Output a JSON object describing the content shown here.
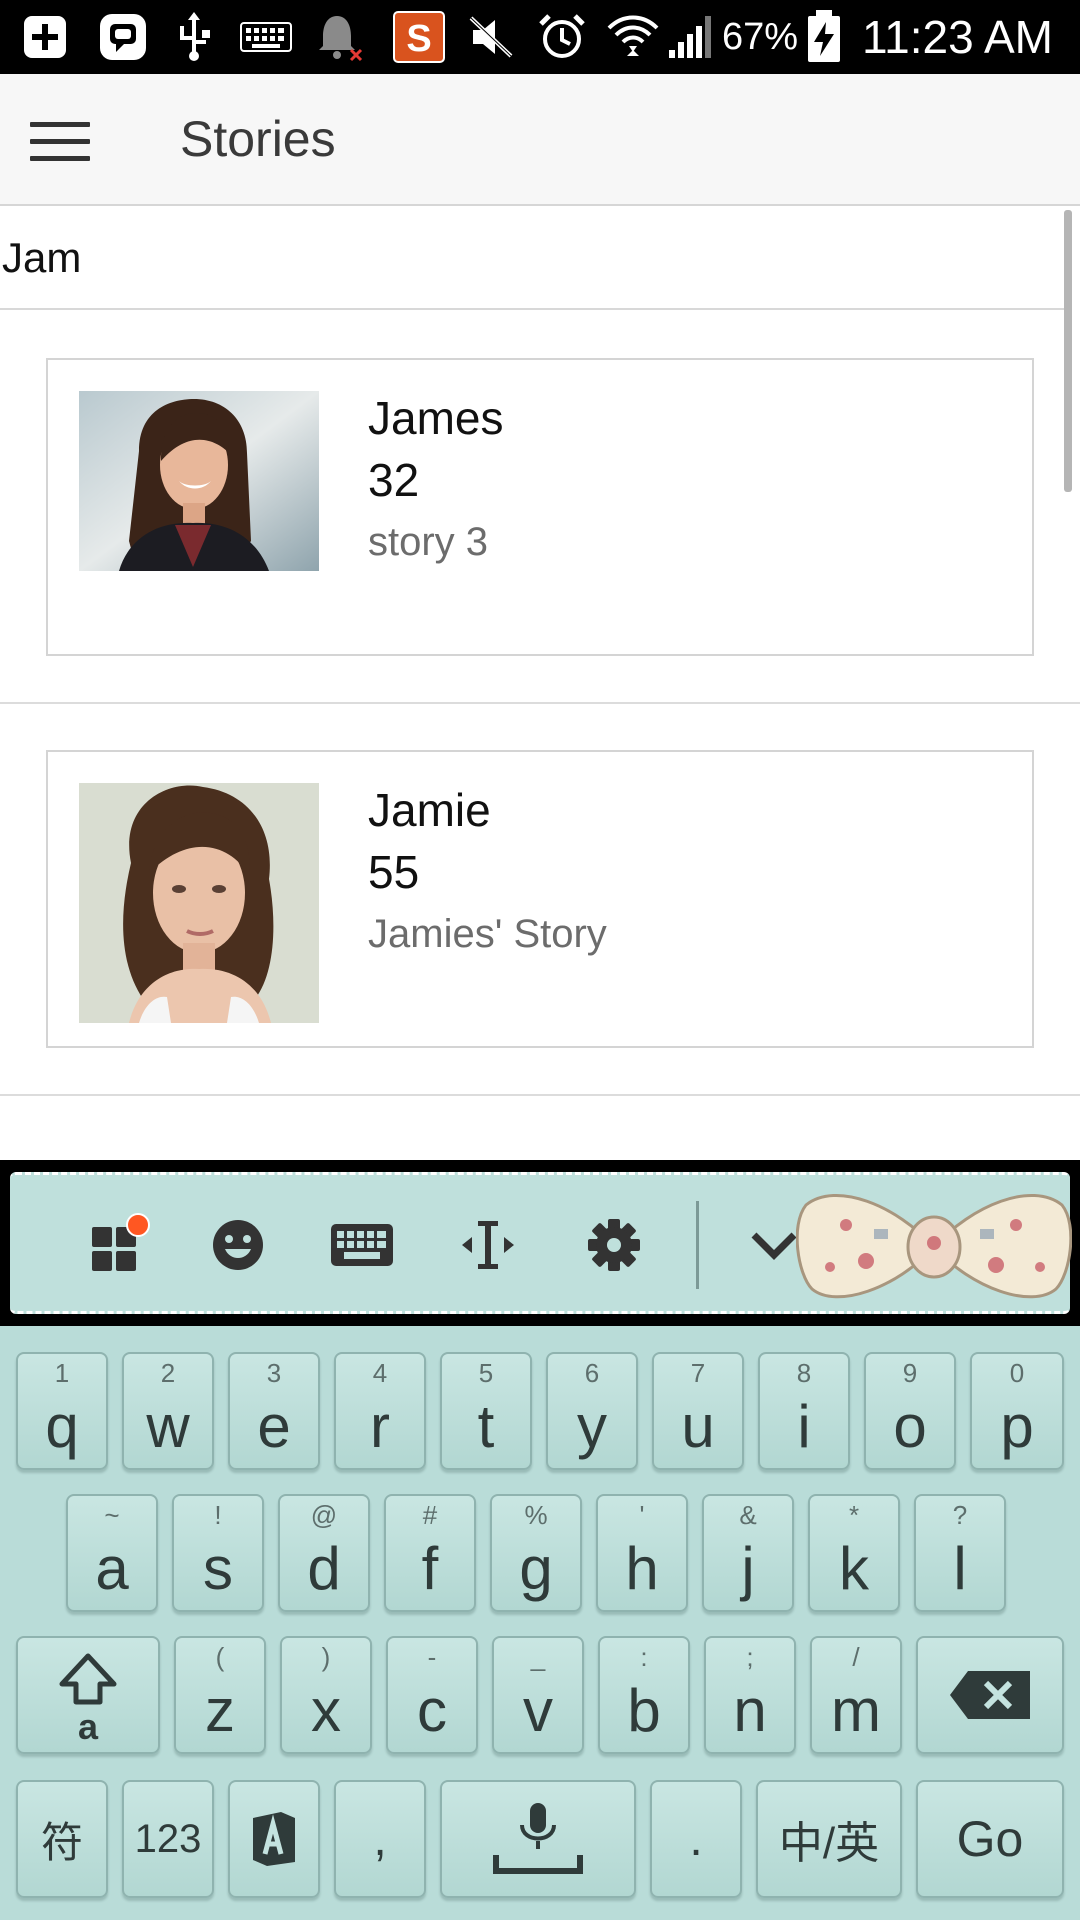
{
  "status_bar": {
    "battery_percent": "67%",
    "time": "11:23 AM",
    "icons": [
      "add-icon",
      "bbm-icon",
      "usb-icon",
      "keyboard-icon",
      "notification-muted-icon",
      "s-app-icon",
      "mute-icon",
      "alarm-icon",
      "wifi-icon",
      "signal-icon",
      "battery-charging-icon"
    ]
  },
  "app_bar": {
    "title": "Stories"
  },
  "search": {
    "value": "Jam"
  },
  "stories": [
    {
      "name": "James",
      "age": "32",
      "story": "story 3"
    },
    {
      "name": "Jamie",
      "age": "55",
      "story": "Jamies' Story"
    }
  ],
  "keyboard": {
    "toolbar_icons": [
      "apps-icon",
      "emoji-icon",
      "keyboard-icon",
      "cursor-icon",
      "settings-icon",
      "collapse-icon"
    ],
    "row1": [
      {
        "label": "q",
        "hint": "1"
      },
      {
        "label": "w",
        "hint": "2"
      },
      {
        "label": "e",
        "hint": "3"
      },
      {
        "label": "r",
        "hint": "4"
      },
      {
        "label": "t",
        "hint": "5"
      },
      {
        "label": "y",
        "hint": "6"
      },
      {
        "label": "u",
        "hint": "7"
      },
      {
        "label": "i",
        "hint": "8"
      },
      {
        "label": "o",
        "hint": "9"
      },
      {
        "label": "p",
        "hint": "0"
      }
    ],
    "row2": [
      {
        "label": "a",
        "hint": "~"
      },
      {
        "label": "s",
        "hint": "!"
      },
      {
        "label": "d",
        "hint": "@"
      },
      {
        "label": "f",
        "hint": "#"
      },
      {
        "label": "g",
        "hint": "%"
      },
      {
        "label": "h",
        "hint": "'"
      },
      {
        "label": "j",
        "hint": "&"
      },
      {
        "label": "k",
        "hint": "*"
      },
      {
        "label": "l",
        "hint": "?"
      }
    ],
    "row3": [
      {
        "label": "z",
        "hint": "("
      },
      {
        "label": "x",
        "hint": ")"
      },
      {
        "label": "c",
        "hint": "-"
      },
      {
        "label": "v",
        "hint": "_"
      },
      {
        "label": "b",
        "hint": ":"
      },
      {
        "label": "n",
        "hint": ";"
      },
      {
        "label": "m",
        "hint": "/"
      }
    ],
    "shift_label": "a",
    "symbols_label": "符",
    "numbers_label": "123",
    "comma_label": ",",
    "period_label": ".",
    "lang_label": "中/英",
    "go_label": "Go"
  }
}
